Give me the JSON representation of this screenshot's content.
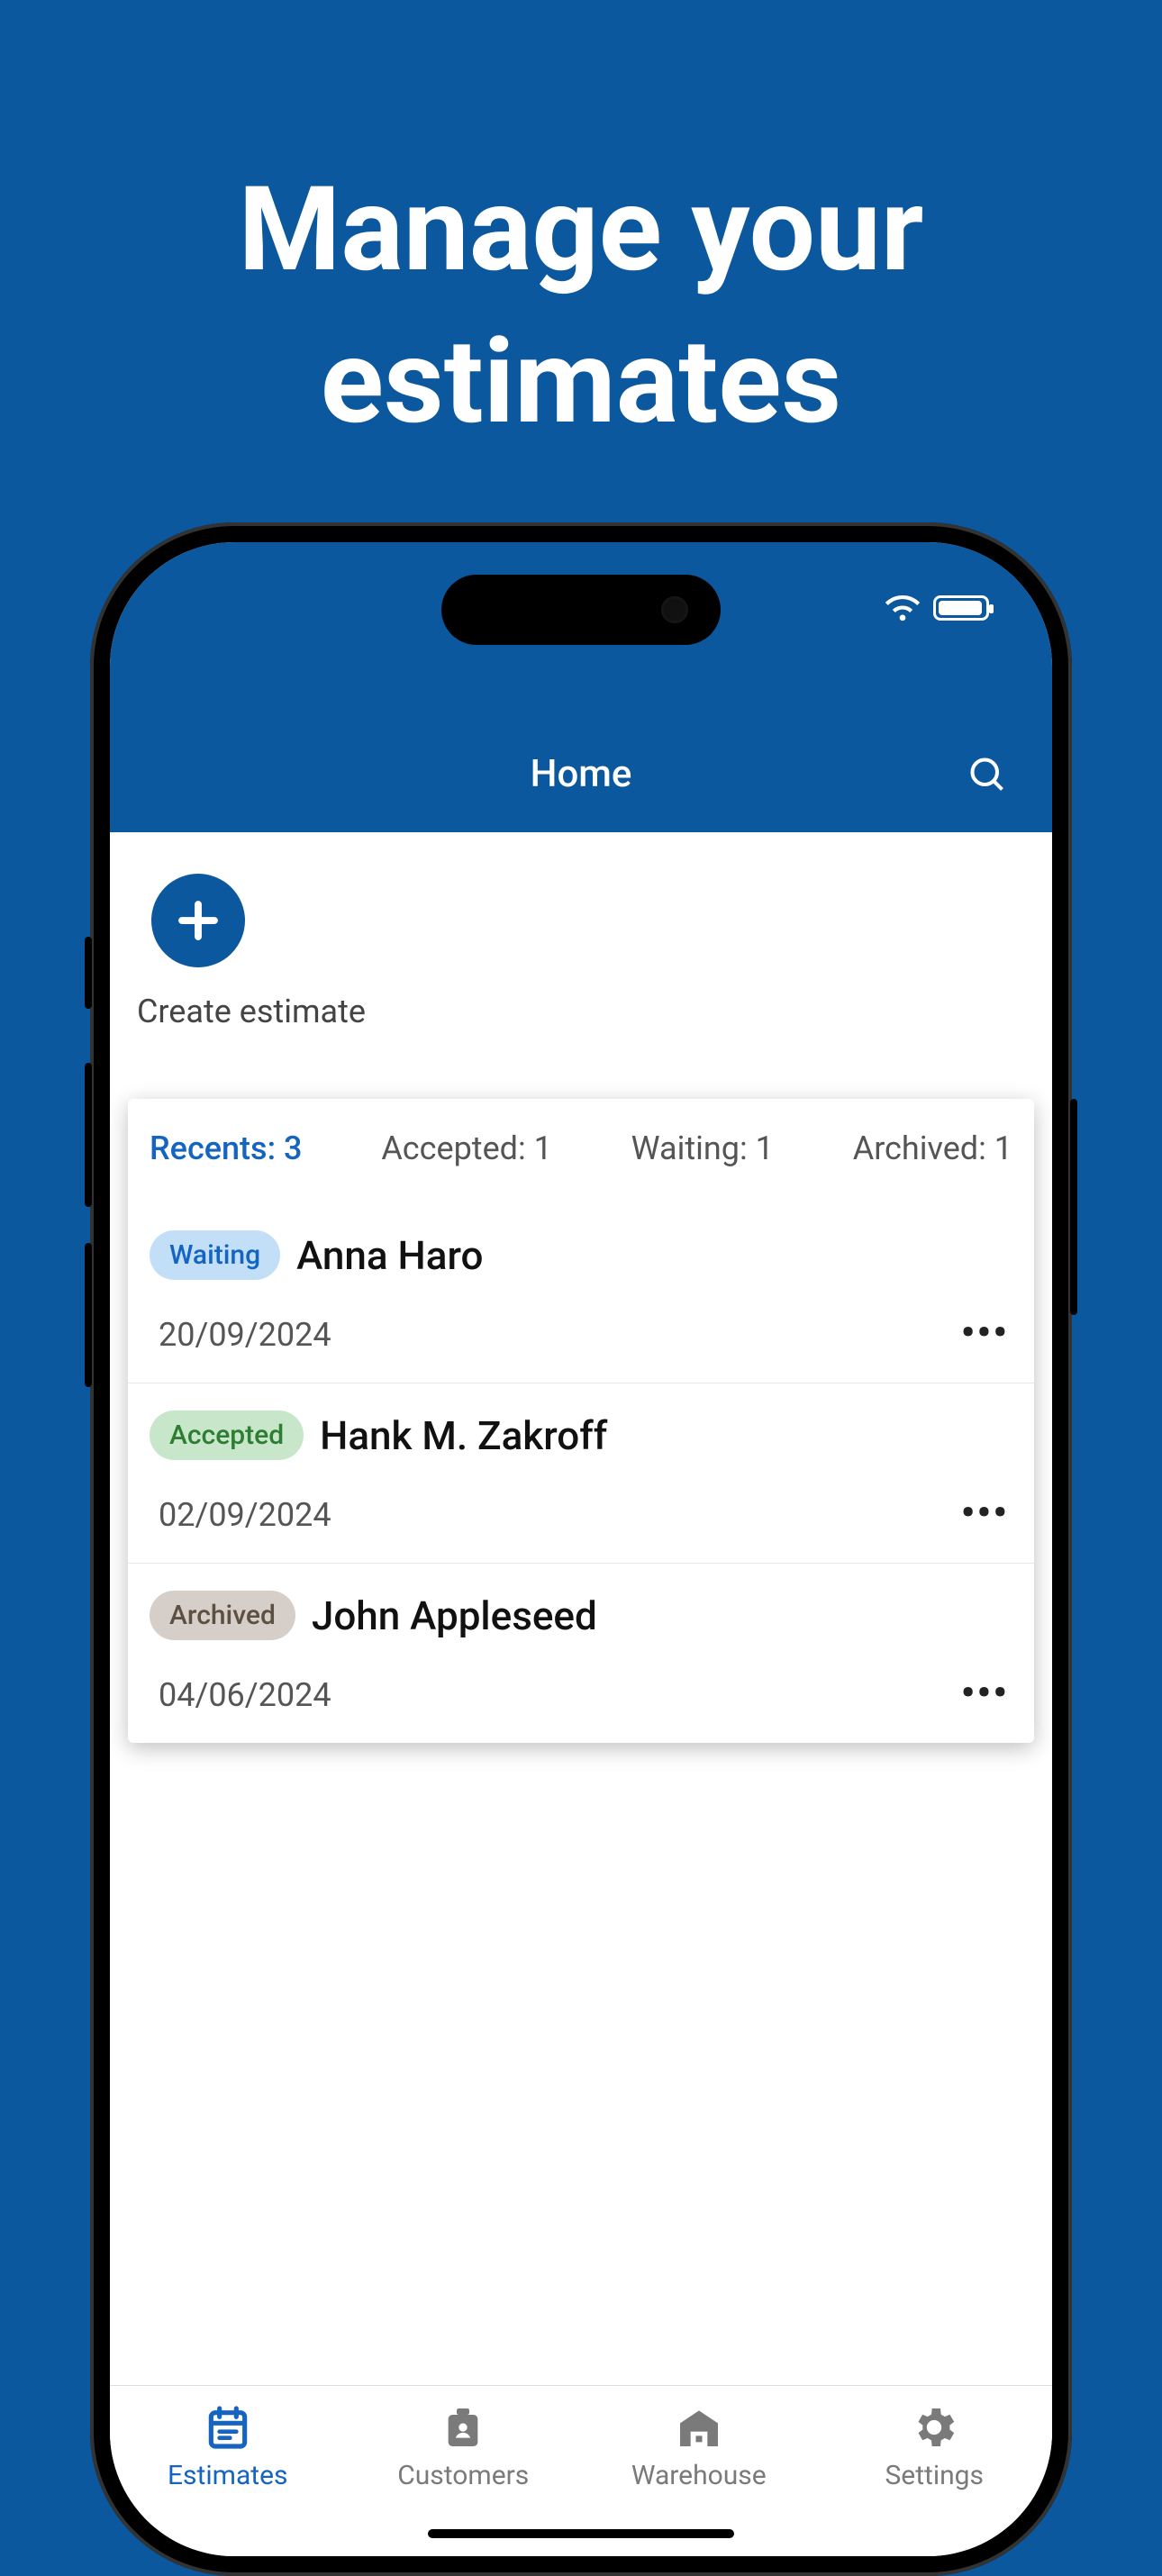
{
  "promo": {
    "title_line1": "Manage your",
    "title_line2": "estimates"
  },
  "statusbar": {
    "wifi": true,
    "battery_level": "full"
  },
  "appbar": {
    "title": "Home",
    "search_icon": "search"
  },
  "create": {
    "icon": "plus",
    "label": "Create estimate"
  },
  "filters": {
    "recents": {
      "label": "Recents: 3"
    },
    "accepted": {
      "label": "Accepted: 1"
    },
    "waiting": {
      "label": "Waiting: 1"
    },
    "archived": {
      "label": "Archived: 1"
    },
    "active": "recents"
  },
  "rows": [
    {
      "status": "waiting",
      "status_label": "Waiting",
      "name": "Anna Haro",
      "date": "20/09/2024"
    },
    {
      "status": "accepted",
      "status_label": "Accepted",
      "name": "Hank M. Zakroff",
      "date": "02/09/2024"
    },
    {
      "status": "archived",
      "status_label": "Archived",
      "name": "John Appleseed",
      "date": "04/06/2024"
    }
  ],
  "nav": {
    "items": [
      {
        "key": "estimates",
        "label": "Estimates"
      },
      {
        "key": "customers",
        "label": "Customers"
      },
      {
        "key": "warehouse",
        "label": "Warehouse"
      },
      {
        "key": "settings",
        "label": "Settings"
      }
    ],
    "active": "estimates"
  },
  "colors": {
    "brand": "#0b589e",
    "accent": "#1565c0"
  }
}
